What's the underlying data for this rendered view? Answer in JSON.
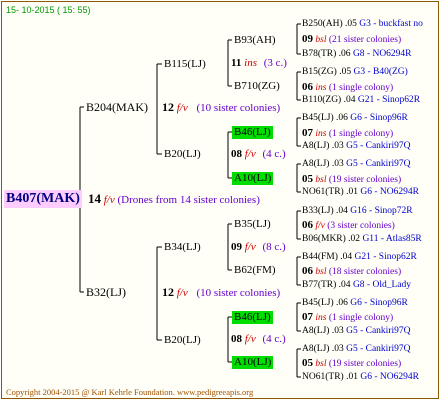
{
  "header": {
    "date": "15- 10-2015 ( 15: 55)"
  },
  "root": {
    "name": "B407(MAK)",
    "count": "14",
    "fl": "f/v",
    "note": "(Drones from 14 sister colonies)"
  },
  "gen1": [
    {
      "name": "B204(MAK)",
      "count": "12",
      "fl": "f/v",
      "note": "(10 sister colonies)"
    },
    {
      "name": "B32(LJ)",
      "count": "12",
      "fl": "f/v",
      "note": "(10 sister colonies)"
    }
  ],
  "gen2": [
    {
      "name": "B115(LJ)",
      "count": "11",
      "fl": "ins",
      "note": "(3 c.)"
    },
    {
      "name": "B20(LJ)",
      "count": "08",
      "fl": "f/v",
      "note": "(4 c.)"
    },
    {
      "name": "B34(LJ)",
      "count": "09",
      "fl": "f/v",
      "note": "(8 c.)"
    },
    {
      "name": "B20(LJ)",
      "count": "08",
      "fl": "f/v",
      "note": "(4 c.)"
    }
  ],
  "gen3": [
    {
      "name": "B93(AH)"
    },
    {
      "name": "B710(ZG)"
    },
    {
      "name": "B46(LJ)"
    },
    {
      "name": "A10(LJ)"
    },
    {
      "name": "B35(LJ)"
    },
    {
      "name": "B62(FM)"
    },
    {
      "name": "B46(LJ)"
    },
    {
      "name": "A10(LJ)"
    }
  ],
  "gen4": [
    {
      "top": "B250(AH) .05",
      "top_b": "G3 - buckfast no",
      "count": "09",
      "fl": "bsl",
      "note": "(21 sister colonies)",
      "bottom": "B78(TR) .06",
      "bottom_b": "G8 - NO6294R"
    },
    {
      "top": "B15(ZG) .05",
      "top_b": "G3 - B40(ZG)",
      "count": "06",
      "fl": "ins",
      "note": "(1 single colony)",
      "bottom": "B110(ZG) .04",
      "bottom_b": "G21 - Sinop62R"
    },
    {
      "top": "B45(LJ) .06",
      "top_b": "G6 - Sinop96R",
      "count": "07",
      "fl": "ins",
      "note": "(1 single colony)",
      "bottom": "A8(LJ) .03",
      "bottom_b": "G5 - Cankiri97Q"
    },
    {
      "top": "A8(LJ) .03",
      "top_b": "G5 - Cankiri97Q",
      "count": "05",
      "fl": "bsl",
      "note": "(19 sister colonies)",
      "bottom": "NO61(TR) .01",
      "bottom_b": "G6 - NO6294R"
    },
    {
      "top": "B33(LJ) .04",
      "top_b": "G16 - Sinop72R",
      "count": "06",
      "fl": "f/v",
      "note": "(3 sister colonies)",
      "bottom": "B06(MKR) .02",
      "bottom_b": "G11 - Atlas85R"
    },
    {
      "top": "B44(FM) .04",
      "top_b": "G21 - Sinop62R",
      "count": "06",
      "fl": "bsl",
      "note": "(18 sister colonies)",
      "bottom": "B77(TR) .04",
      "bottom_b": "G8 - Old_Lady"
    },
    {
      "top": "B45(LJ) .06",
      "top_b": "G6 - Sinop96R",
      "count": "07",
      "fl": "ins",
      "note": "(1 single colony)",
      "bottom": "A8(LJ) .03",
      "bottom_b": "G5 - Cankiri97Q"
    },
    {
      "top": "A8(LJ) .03",
      "top_b": "G5 - Cankiri97Q",
      "count": "05",
      "fl": "bsl",
      "note": "(19 sister colonies)",
      "bottom": "NO61(TR) .01",
      "bottom_b": "G6 - NO6294R"
    }
  ],
  "footer": {
    "copyright": "Copyright 2004-2015 @ Karl Kehrle Foundation.   www.pedigreeapis.org"
  }
}
